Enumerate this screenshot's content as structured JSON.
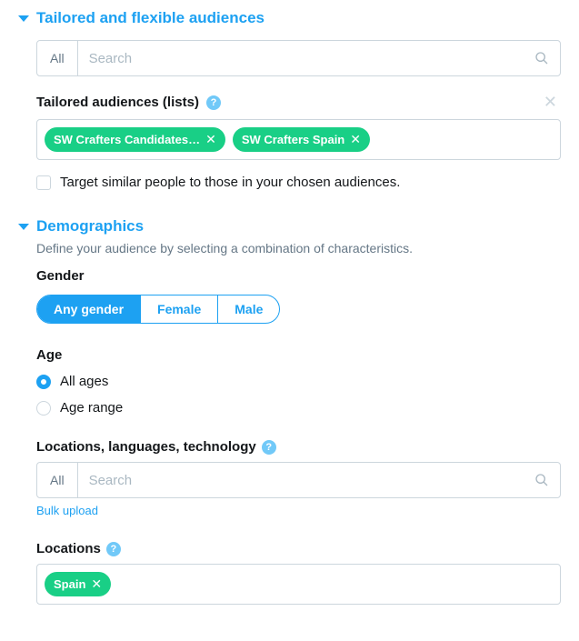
{
  "section1": {
    "title": "Tailored and flexible audiences",
    "search_all": "All",
    "search_placeholder": "Search",
    "tailored_label": "Tailored audiences (lists)",
    "chips": [
      {
        "label": "SW Crafters Candidates…"
      },
      {
        "label": "SW Crafters Spain"
      }
    ],
    "similar_label": "Target similar people to those in your chosen audiences."
  },
  "section2": {
    "title": "Demographics",
    "desc": "Define your audience by selecting a combination of characteristics.",
    "gender_label": "Gender",
    "gender_options": {
      "any": "Any gender",
      "female": "Female",
      "male": "Male"
    },
    "age_label": "Age",
    "age_all": "All ages",
    "age_range": "Age range",
    "llt_label": "Locations, languages, technology",
    "llt_all": "All",
    "llt_placeholder": "Search",
    "bulk_upload": "Bulk upload",
    "locations_label": "Locations",
    "location_chips": [
      {
        "label": "Spain"
      }
    ]
  }
}
